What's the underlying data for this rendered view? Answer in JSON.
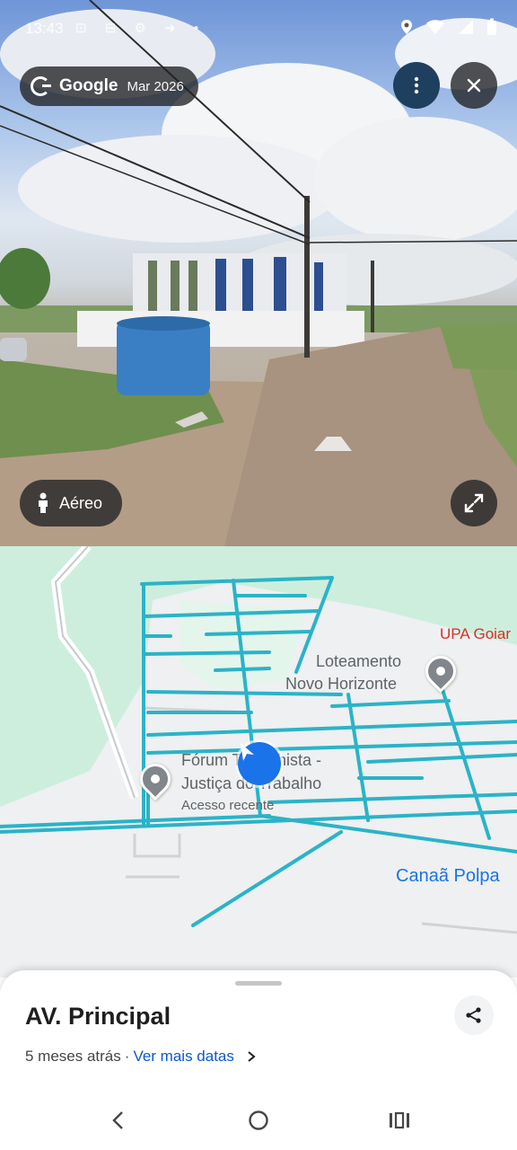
{
  "status_bar": {
    "time": "13:43",
    "icons": [
      "location-icon",
      "wifi-icon",
      "signal-icon",
      "battery-icon"
    ]
  },
  "street_view": {
    "brand": "Google",
    "date": "Mar 2026",
    "aerial_button": "Aéreo"
  },
  "map": {
    "labels": {
      "loteamento_line1": "Loteamento",
      "loteamento_line2": "Novo Horizonte",
      "forum_line1": "Fórum Trabalhista -",
      "forum_line2": "Justiça do Trabalho",
      "forum_sub": "Acesso recente",
      "upa": "UPA Goiar",
      "canaa": "Canaã Polpa"
    },
    "colors": {
      "route": "#2bb3c7",
      "land": "#cdeedd",
      "road": "#ffffff",
      "accent": "#1a73e8"
    }
  },
  "sheet": {
    "title": "AV. Principal",
    "time_ago": "5 meses atrás",
    "separator": "·",
    "more_dates": "Ver mais datas"
  }
}
